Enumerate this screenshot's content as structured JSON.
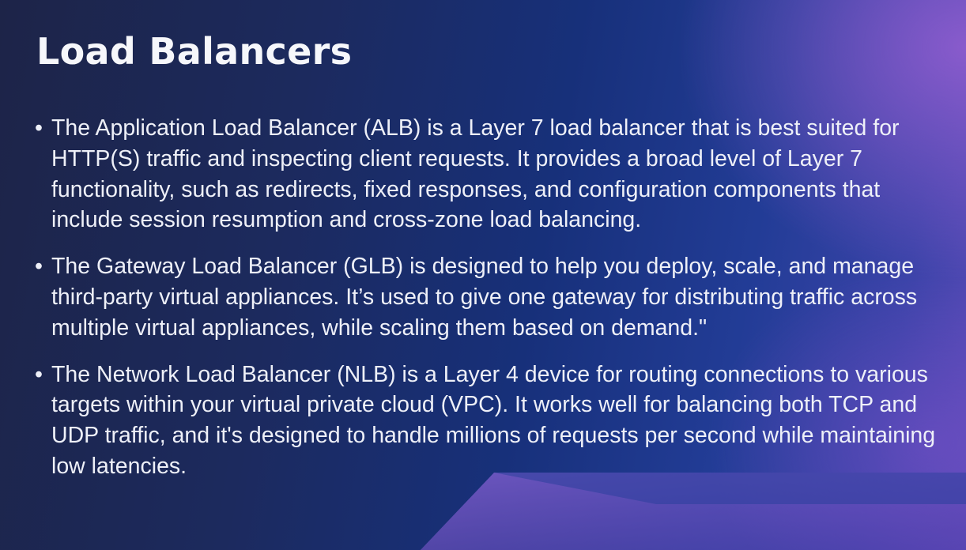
{
  "slide": {
    "title": "Load Balancers",
    "bullet_symbol": "•",
    "bullets": [
      {
        "text": "The Application Load Balancer (ALB) is a Layer 7 load balancer that is best suited for HTTP(S) traffic and inspecting client requests. It provides a broad level of Layer 7 functionality, such as redirects, fixed responses, and configuration components that include session resumption and cross-zone load balancing."
      },
      {
        "text": "The Gateway Load Balancer (GLB) is designed to help you deploy, scale, and manage third-party virtual appliances. It’s used to give one gateway for distributing traffic across multiple virtual appliances, while scaling them based on demand.\""
      },
      {
        "text": "The Network Load Balancer (NLB) is a Layer 4 device for routing connections to various targets within your virtual private cloud (VPC). It works well for balancing both TCP and UDP traffic, and it's designed to handle millions of requests per second while maintaining low latencies."
      }
    ]
  },
  "colors": {
    "text": "#eef0f8",
    "background_dark": "#1d2448",
    "background_blue": "#17307a",
    "accent_purple": "#965fd2"
  }
}
